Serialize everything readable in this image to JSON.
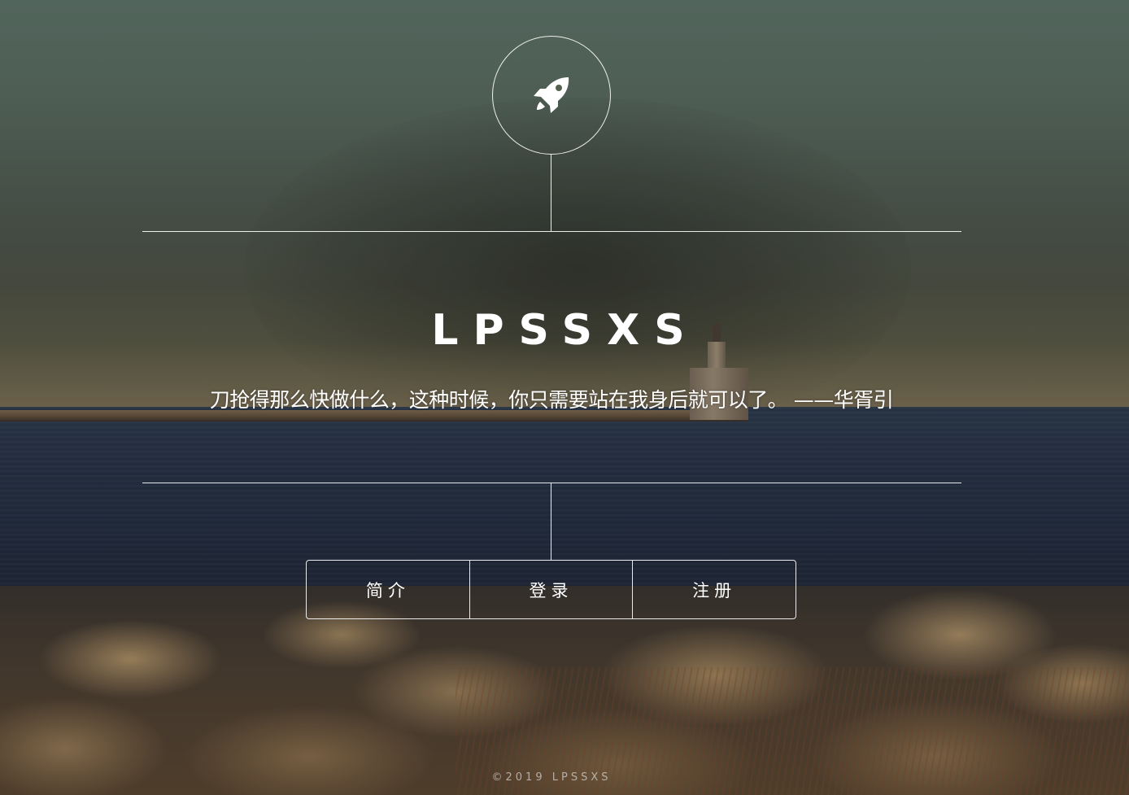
{
  "logo": {
    "icon": "rocket-icon"
  },
  "site": {
    "title": "LPSSXS",
    "quote": "刀抢得那么快做什么，这种时候，你只需要站在我身后就可以了。 ——华胥引"
  },
  "nav": {
    "items": [
      {
        "label": "简介"
      },
      {
        "label": "登录"
      },
      {
        "label": "注册"
      }
    ]
  },
  "footer": {
    "copyright": "©2019 LPSSXS"
  },
  "colors": {
    "foreground": "#ffffff",
    "sky": "#5e7369",
    "sea": "#263246",
    "rocks": "#b09268"
  }
}
